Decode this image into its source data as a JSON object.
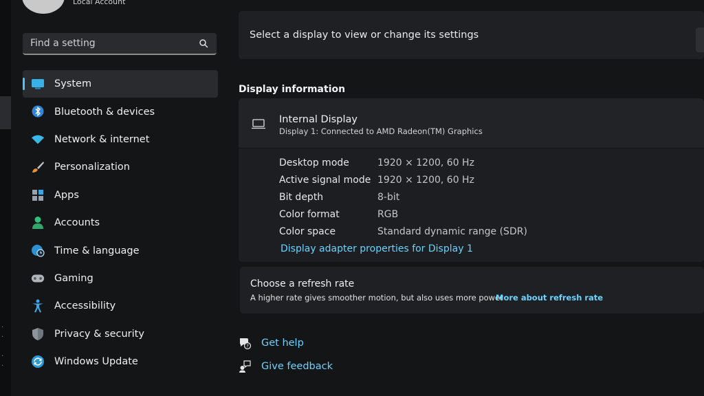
{
  "account": {
    "type": "Local Account"
  },
  "search": {
    "placeholder": "Find a setting"
  },
  "sidebar": {
    "items": [
      {
        "label": "System",
        "icon": "monitor-icon",
        "active": true
      },
      {
        "label": "Bluetooth & devices",
        "icon": "bluetooth-icon"
      },
      {
        "label": "Network & internet",
        "icon": "wifi-icon"
      },
      {
        "label": "Personalization",
        "icon": "brush-icon"
      },
      {
        "label": "Apps",
        "icon": "apps-icon"
      },
      {
        "label": "Accounts",
        "icon": "person-icon"
      },
      {
        "label": "Time & language",
        "icon": "globe-clock-icon"
      },
      {
        "label": "Gaming",
        "icon": "gamepad-icon"
      },
      {
        "label": "Accessibility",
        "icon": "accessibility-icon"
      },
      {
        "label": "Privacy & security",
        "icon": "shield-icon"
      },
      {
        "label": "Windows Update",
        "icon": "update-icon"
      }
    ]
  },
  "main": {
    "select_display": "Select a display to view or change its settings",
    "display_info_title": "Display information",
    "display": {
      "name": "Internal Display",
      "connection": "Display 1: Connected to AMD Radeon(TM) Graphics",
      "rows": [
        {
          "label": "Desktop mode",
          "value": "1920 × 1200, 60 Hz"
        },
        {
          "label": "Active signal mode",
          "value": "1920 × 1200, 60 Hz"
        },
        {
          "label": "Bit depth",
          "value": "8-bit"
        },
        {
          "label": "Color format",
          "value": "RGB"
        },
        {
          "label": "Color space",
          "value": "Standard dynamic range (SDR)"
        }
      ],
      "adapter_link": "Display adapter properties for Display 1"
    },
    "refresh": {
      "title": "Choose a refresh rate",
      "description": "A higher rate gives smoother motion, but also uses more power",
      "link": "More about refresh rate"
    },
    "help": {
      "get_help": "Get help",
      "give_feedback": "Give feedback"
    }
  },
  "colors": {
    "accent": "#4cc2ff",
    "link": "#6ad3ff",
    "background": "#141517",
    "card": "#1f2023"
  }
}
